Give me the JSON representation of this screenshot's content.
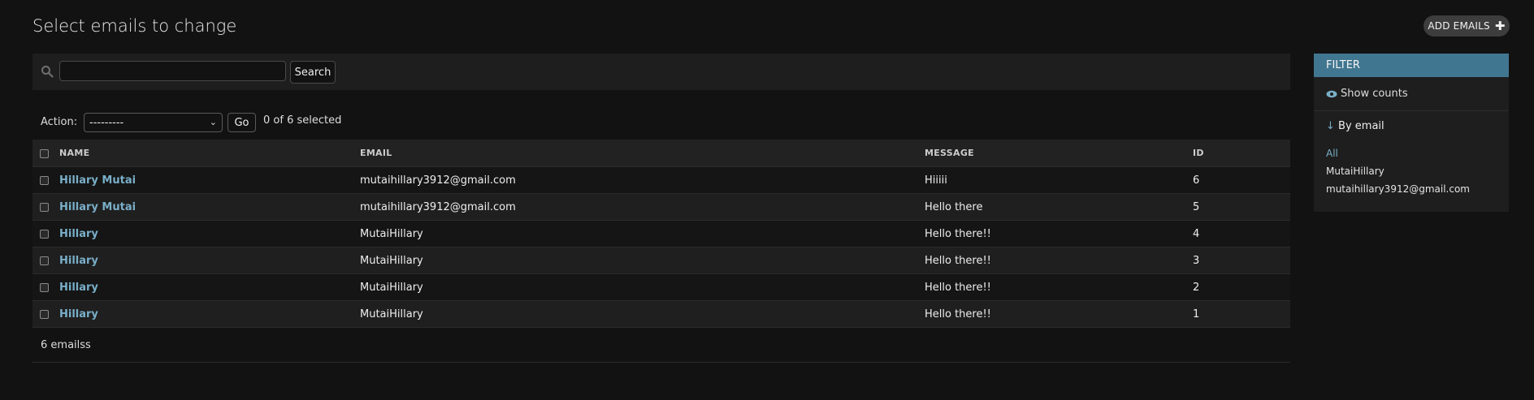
{
  "page": {
    "title": "Select emails to change",
    "add_label": "ADD EMAILS"
  },
  "search": {
    "value": "",
    "button": "Search"
  },
  "actions": {
    "label": "Action:",
    "selected": "---------",
    "go": "Go",
    "counter": "0 of 6 selected"
  },
  "table": {
    "headers": {
      "name": "NAME",
      "email": "EMAIL",
      "message": "MESSAGE",
      "id": "ID"
    },
    "rows": [
      {
        "name": "Hillary Mutai",
        "email": "mutaihillary3912@gmail.com",
        "message": "Hiiiii",
        "id": "6"
      },
      {
        "name": "Hillary Mutai",
        "email": "mutaihillary3912@gmail.com",
        "message": "Hello there",
        "id": "5"
      },
      {
        "name": "Hillary",
        "email": "MutaiHillary",
        "message": "Hello there!!",
        "id": "4"
      },
      {
        "name": "Hillary",
        "email": "MutaiHillary",
        "message": "Hello there!!",
        "id": "3"
      },
      {
        "name": "Hillary",
        "email": "MutaiHillary",
        "message": "Hello there!!",
        "id": "2"
      },
      {
        "name": "Hillary",
        "email": "MutaiHillary",
        "message": "Hello there!!",
        "id": "1"
      }
    ]
  },
  "footer": {
    "count": "6 emailss"
  },
  "filter": {
    "title": "FILTER",
    "show_counts": "Show counts",
    "by_email": "By email",
    "options": {
      "all": "All",
      "opt1": "MutaiHillary",
      "opt2": "mutaihillary3912@gmail.com"
    }
  },
  "colors": {
    "accent": "#79aec8",
    "filter_header": "#417690",
    "background": "#121212"
  }
}
